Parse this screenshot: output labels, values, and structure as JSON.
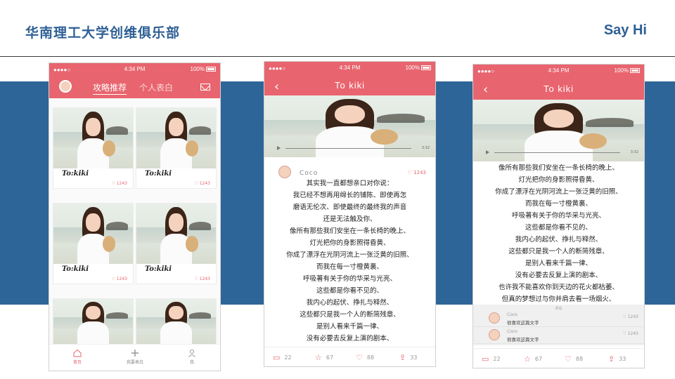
{
  "header": {
    "title": "华南理工大学创维俱乐部",
    "sayhi": "Say Hi"
  },
  "status": {
    "signal": "●●●●○",
    "time": "4:34 PM",
    "battery": "100%"
  },
  "phone1": {
    "tab_active": "攻略推荐",
    "tab_inactive": "个人表白",
    "cards": [
      {
        "signature": "To:kiki",
        "likes": "1243"
      },
      {
        "signature": "To:kiki",
        "likes": "1243"
      },
      {
        "signature": "To:kiki",
        "likes": "1243"
      },
      {
        "signature": "To:kiki",
        "likes": "1243"
      },
      {
        "signature": "",
        "likes": ""
      },
      {
        "signature": "",
        "likes": ""
      }
    ],
    "bottom_nav": {
      "home": "首页",
      "post": "我要表白",
      "me": "我"
    }
  },
  "detail": {
    "nav_title": "To kiki",
    "back": "‹",
    "player_time": "3:32",
    "author_name": "Coco",
    "author_likes": "1243",
    "poem2": [
      "其实我一直都想亲口对你说：",
      "我已经不想再用绵长的铺陈、即使再怎",
      "磨语无伦次、即使最终的最终我的声音",
      "还是无法触及你、",
      "像所有那些我们安坐在一条长椅的晚上、",
      "灯光把你的身影照得昏黄、",
      "你成了漂浮在光阴河流上一张泛黄的旧照、",
      "而我在每一寸橙黄裏、",
      "呼吸著有关于你的华采与光亮、",
      "这些都是你看不见的、",
      "我内心的起伏、挣扎与释然、",
      "这些都只是我一个人的断简残章、",
      "是别人看来千篇一律、",
      "没有必要去反复上演的剧本、"
    ],
    "poem3": [
      "像所有那些我们安坐在一条长椅的晚上、",
      "灯光把你的身影照得昏黄、",
      "你成了漂浮在光阴河流上一张泛黄的旧照、",
      "而我在每一寸橙黄裏、",
      "呼吸著有关于你的华采与光亮、",
      "这些都是你看不见的、",
      "我内心的起伏、挣扎与释然、",
      "这些都只是我一个人的断简残章、",
      "是别人看来千篇一律、",
      "没有必要去反复上演的剧本、",
      "也许我不能喜欢你到天边的花火都枯萎、",
      "但真的梦想过与你并肩去看一场烟火、"
    ],
    "comments_header": "评论",
    "comments": [
      {
        "name": "Coco",
        "text": "很喜欢这篇文字",
        "likes": "1243"
      },
      {
        "name": "Coco",
        "text": "很喜欢这篇文字",
        "likes": "1243"
      }
    ],
    "actions": {
      "comments": "22",
      "stars": "67",
      "hearts": "88",
      "shares": "33"
    }
  },
  "colors": {
    "brand_pink": "#e8646e",
    "title_blue": "#2e5f95",
    "band_blue": "#2e6598"
  }
}
